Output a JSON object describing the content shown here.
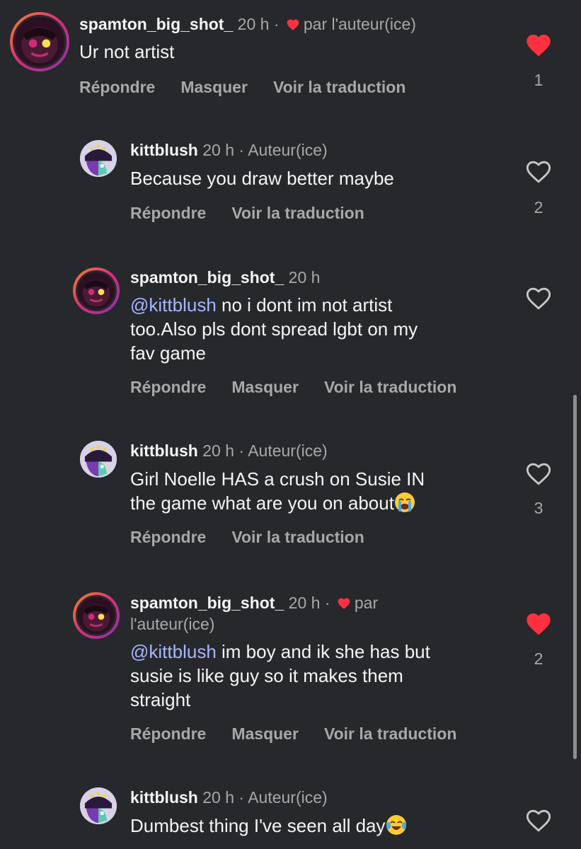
{
  "actions": {
    "reply": "Répondre",
    "hide": "Masquer",
    "translate": "Voir la traduction"
  },
  "comments": [
    {
      "username": "spamton_big_shot_",
      "time": "20 h",
      "separator": "·",
      "tag": "par l'auteur(ice)",
      "text": "Ur not artist",
      "liked": true,
      "likes": "1"
    },
    {
      "username": "kittblush",
      "time": "20 h",
      "separator": "·",
      "tag": "Auteur(ice)",
      "text": "Because you draw better maybe",
      "liked": false,
      "likes": "2"
    },
    {
      "username": "spamton_big_shot_",
      "time": "20 h",
      "mention": "@kittblush",
      "text_line1": " no i dont im not artist",
      "text_line2": "too.Also pls dont spread lgbt on my",
      "text_line3": "fav game",
      "liked": false
    },
    {
      "username": "kittblush",
      "time": "20 h",
      "separator": "·",
      "tag": "Auteur(ice)",
      "text_line1": "Girl Noelle HAS a crush on Susie IN",
      "text_line2": "the game what are you on about",
      "emoji": "loudly-crying-face",
      "liked": false,
      "likes": "3"
    },
    {
      "username": "spamton_big_shot_",
      "time": "20 h",
      "separator": "·",
      "tag_word": "par",
      "tag_line2": "l'auteur(ice)",
      "mention": "@kittblush",
      "text_line1": " im boy and ik she has but",
      "text_line2": "susie is like guy so it makes them",
      "text_line3": "straight",
      "liked": true,
      "likes": "2"
    },
    {
      "username": "kittblush",
      "time": "20 h",
      "separator": "·",
      "tag": "Auteur(ice)",
      "text": "Dumbest thing I've seen all day",
      "emoji": "face-with-tears-of-joy",
      "liked": false
    }
  ],
  "colors": {
    "background": "#26282c",
    "like_red": "#ff3040",
    "mention": "#a7b6ff",
    "muted": "#a8a8a8"
  }
}
